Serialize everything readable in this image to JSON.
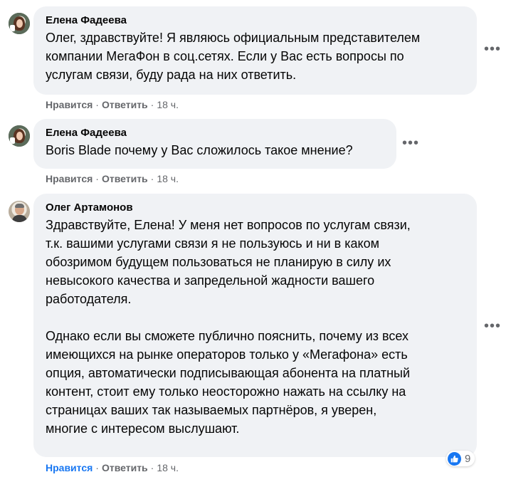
{
  "comments": [
    {
      "author": "Елена Фадеева",
      "text": "Олег, здравствуйте! Я являюсь официальным представителем\nкомпании МегаФон в соц.сетях. Если у Вас есть вопросы по\nуслугам связи, буду рада на них ответить.",
      "like_label": "Нравится",
      "reply_label": "Ответить",
      "time": "18 ч."
    },
    {
      "author": "Елена Фадеева",
      "text": "Boris Blade почему у Вас сложилось такое мнение?",
      "like_label": "Нравится",
      "reply_label": "Ответить",
      "time": "18 ч."
    },
    {
      "author": "Олег Артамонов",
      "text": "Здравствуйте, Елена! У меня нет вопросов по услугам связи,\nт.к. вашими услугами связи я не пользуюсь и ни в каком\nобозримом будущем пользоваться не планирую в силу их\nневысокого качества и запредельной жадности вашего\nработодателя.\n\nОднако если вы сможете публично пояснить, почему из всех\nимеющихся на рынке операторов только у «Мегафона» есть\nопция, автоматически подписывающая абонента на платный\nконтент, стоит ему только неосторожно нажать на ссылку на\nстраницах ваших так называемых партнёров, я уверен,\nмногие с интересом выслушают.",
      "like_label": "Нравится",
      "reply_label": "Ответить",
      "time": "18 ч.",
      "reaction_count": "9",
      "liked": true
    }
  ],
  "separator": "·",
  "more_glyph": "•••",
  "colors": {
    "bubble": "#f0f2f5",
    "text": "#050505",
    "meta": "#65676b",
    "accent": "#1877f2"
  },
  "icons": {
    "like": "thumbs-up-icon",
    "more": "more-horizontal-icon"
  }
}
